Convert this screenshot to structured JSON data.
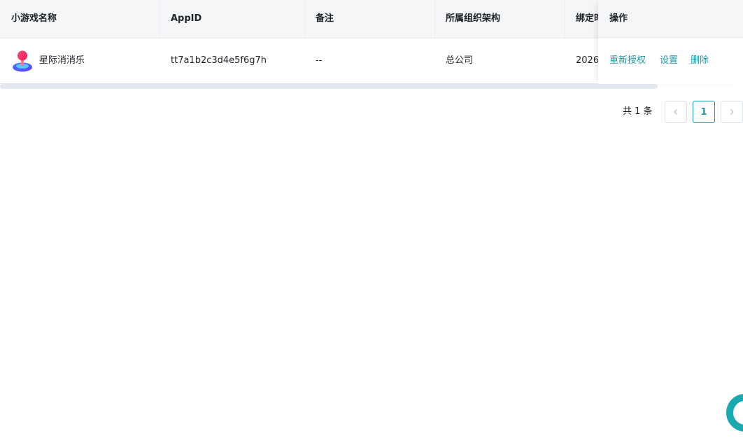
{
  "table": {
    "headers": {
      "name": "小游戏名称",
      "appid": "AppID",
      "remark": "备注",
      "org": "所属组织架构",
      "bind_time": "绑定时间",
      "actions": "操作"
    },
    "rows": [
      {
        "name": "星际消消乐",
        "appid": "tt7a1b2c3d4e5f6g7h",
        "remark": "--",
        "org": "总公司",
        "bind_time": "2026",
        "icon": "game-joystick-icon",
        "actions": {
          "reauth": "重新授权",
          "settings": "设置",
          "delete": "删除"
        }
      }
    ]
  },
  "pagination": {
    "total_label": "共 1 条",
    "current_page": "1",
    "prev_icon": "chevron-left-icon",
    "next_icon": "chevron-right-icon"
  },
  "colors": {
    "accent": "#1b9aaa",
    "header_bg": "#f5f6f7",
    "fab": "#18a9b1"
  },
  "chat_fab_icon": "chat-bubble-icon"
}
